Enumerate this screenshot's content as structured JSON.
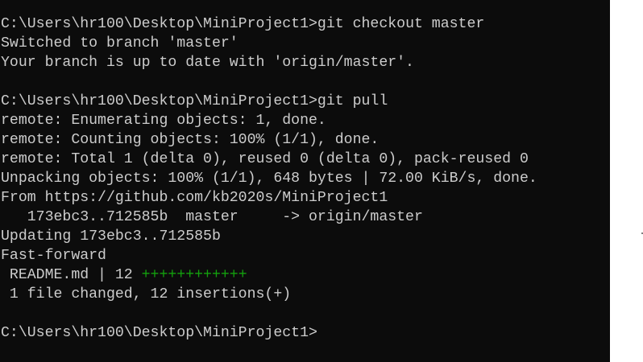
{
  "terminal": {
    "colors": {
      "background": "#0c0c0c",
      "text": "#cccccc",
      "plus_marks": "#13a10e"
    },
    "lines": [
      {
        "id": "prompt-1",
        "prompt": "C:\\Users\\hr100\\Desktop\\MiniProject1>",
        "command": "git checkout master"
      },
      {
        "id": "out-1",
        "text": "Switched to branch 'master'"
      },
      {
        "id": "out-2",
        "text": "Your branch is up to date with 'origin/master'."
      },
      {
        "id": "blank-1",
        "text": ""
      },
      {
        "id": "prompt-2",
        "prompt": "C:\\Users\\hr100\\Desktop\\MiniProject1>",
        "command": "git pull"
      },
      {
        "id": "out-3",
        "text": "remote: Enumerating objects: 1, done."
      },
      {
        "id": "out-4",
        "text": "remote: Counting objects: 100% (1/1), done."
      },
      {
        "id": "out-5",
        "text": "remote: Total 1 (delta 0), reused 0 (delta 0), pack-reused 0"
      },
      {
        "id": "out-6",
        "text": "Unpacking objects: 100% (1/1), 648 bytes | 72.00 KiB/s, done."
      },
      {
        "id": "out-7",
        "text": "From https://github.com/kb2020s/MiniProject1"
      },
      {
        "id": "out-8",
        "text": "   173ebc3..712585b  master     -> origin/master"
      },
      {
        "id": "out-9",
        "text": "Updating 173ebc3..712585b"
      },
      {
        "id": "out-10",
        "text": "Fast-forward"
      },
      {
        "id": "out-11",
        "stat_prefix": " README.md | 12 ",
        "stat_plus": "++++++++++++"
      },
      {
        "id": "out-12",
        "text": " 1 file changed, 12 insertions(+)"
      },
      {
        "id": "blank-2",
        "text": ""
      },
      {
        "id": "prompt-3",
        "prompt": "C:\\Users\\hr100\\Desktop\\MiniProject1>",
        "command": ""
      }
    ]
  }
}
